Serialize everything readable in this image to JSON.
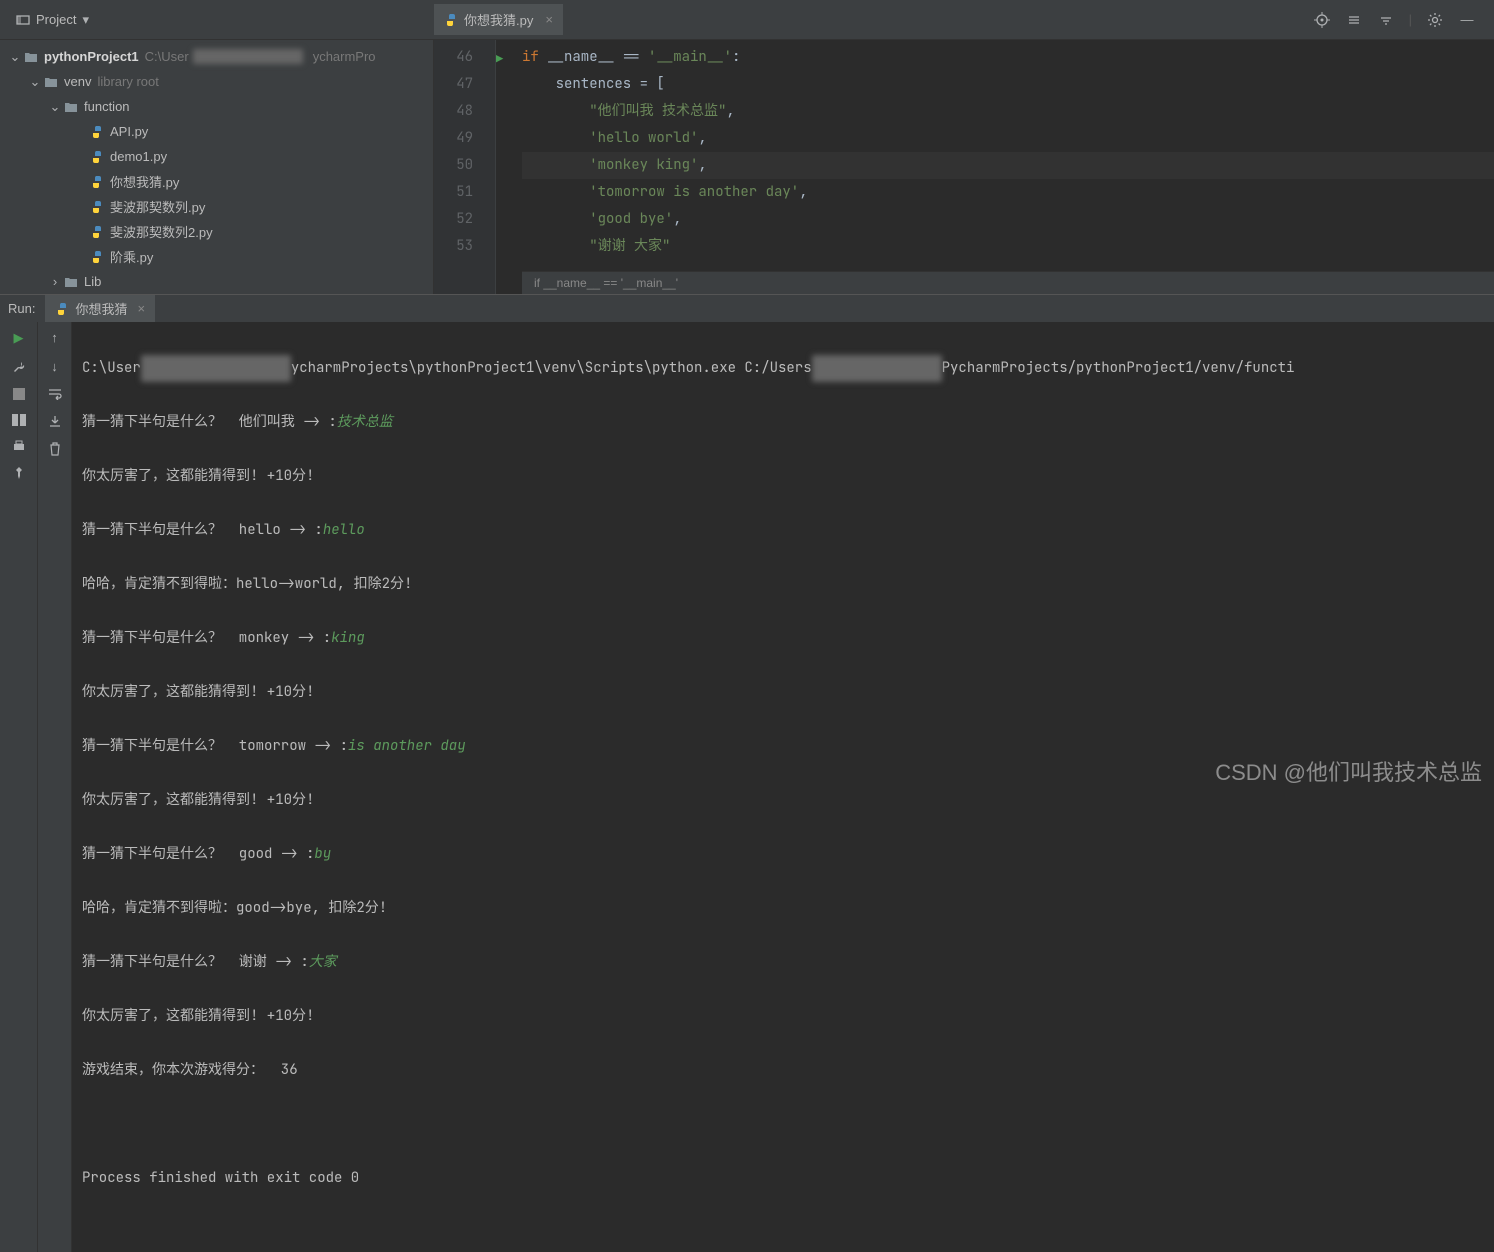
{
  "toolbar": {
    "project_label": "Project"
  },
  "tabs": {
    "open_file": "你想我猜.py"
  },
  "tree": {
    "root_name": "pythonProject1",
    "root_path": "C:\\User",
    "root_path_suffix": "ycharmPro",
    "venv": "venv",
    "venv_hint": "library root",
    "function": "function",
    "files": {
      "api": "API.py",
      "demo1": "demo1.py",
      "guess": "你想我猜.py",
      "fib1": "斐波那契数列.py",
      "fib2": "斐波那契数列2.py",
      "factorial": "阶乘.py"
    },
    "lib": "Lib"
  },
  "editor": {
    "lines": [
      "46",
      "47",
      "48",
      "49",
      "50",
      "51",
      "52",
      "53"
    ],
    "code": {
      "l46_if": "if",
      "l46_rest": " __name__ == ",
      "l46_str": "'__main__'",
      "l46_colon": ":",
      "l47_var": "sentences = [",
      "l48": "\"他们叫我 技术总监\"",
      "l49": "'hello world'",
      "l50": "'monkey king'",
      "l51": "'tomorrow is another day'",
      "l52": "'good bye'",
      "l53": "\"谢谢 大家\"",
      "comma": ","
    },
    "breadcrumb": "if __name__ == '__main__'"
  },
  "run": {
    "label": "Run:",
    "tab": "你想我猜",
    "console": {
      "cmd_pre": "C:\\User",
      "cmd_mid": "ycharmProjects\\pythonProject1\\venv\\Scripts\\python.exe C:/Users",
      "cmd_post": "PycharmProjects/pythonProject1/venv/functi",
      "l1_q": "猜一猜下半句是什么？  他们叫我 -> :",
      "l1_a": "技术总监",
      "l2": "你太厉害了，这都能猜得到! +10分!",
      "l3_q": "猜一猜下半句是什么？  hello -> :",
      "l3_a": "hello",
      "l4": "哈哈，肯定猜不到得啦：hello->world, 扣除2分!",
      "l5_q": "猜一猜下半句是什么？  monkey -> :",
      "l5_a": "king",
      "l6": "你太厉害了，这都能猜得到! +10分!",
      "l7_q": "猜一猜下半句是什么？  tomorrow -> :",
      "l7_a": "is another day",
      "l8": "你太厉害了，这都能猜得到! +10分!",
      "l9_q": "猜一猜下半句是什么？  good -> :",
      "l9_a": "by",
      "l10": "哈哈，肯定猜不到得啦：good->bye, 扣除2分!",
      "l11_q": "猜一猜下半句是什么？  谢谢 -> :",
      "l11_a": "大家",
      "l12": "你太厉害了，这都能猜得到! +10分!",
      "l13": "游戏结束，你本次游戏得分：  36",
      "exit": "Process finished with exit code 0"
    }
  },
  "watermark": "CSDN @他们叫我技术总监"
}
